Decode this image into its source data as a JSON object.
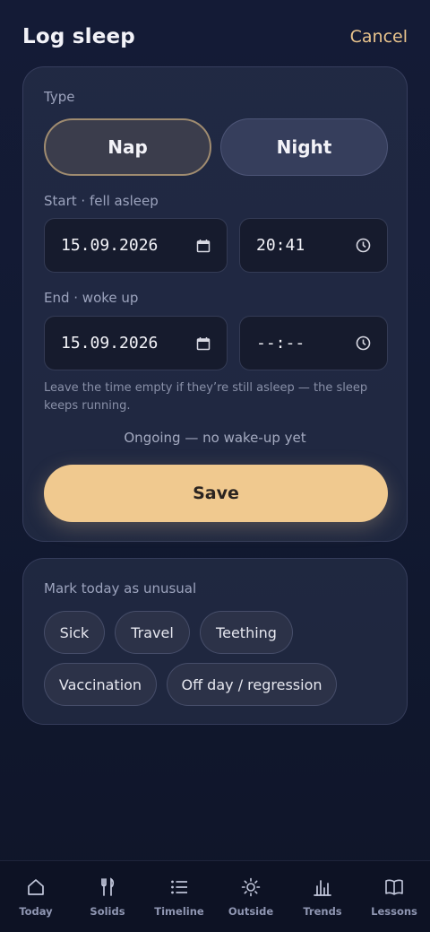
{
  "header": {
    "title": "Log sleep",
    "cancel_label": "Cancel"
  },
  "form": {
    "type_label": "Type",
    "types": [
      {
        "label": "Nap",
        "selected": true
      },
      {
        "label": "Night",
        "selected": false
      }
    ],
    "start_label": "Start · fell asleep",
    "start_date": "15.09.2026",
    "start_time": "20:41",
    "end_label": "End · woke up",
    "end_date": "15.09.2026",
    "end_time": "--:--",
    "hint": "Leave the time empty if they’re still asleep — the sleep keeps running.",
    "status": "Ongoing — no wake-up yet",
    "save_label": "Save",
    "icons": {
      "date": "calendar-icon",
      "time": "clock-icon"
    }
  },
  "unusual": {
    "label": "Mark today as unusual",
    "chips": [
      "Sick",
      "Travel",
      "Teething",
      "Vaccination",
      "Off day / regression"
    ]
  },
  "nav": {
    "items": [
      {
        "label": "Today",
        "icon": "home-icon"
      },
      {
        "label": "Solids",
        "icon": "utensils-icon"
      },
      {
        "label": "Timeline",
        "icon": "list-icon"
      },
      {
        "label": "Outside",
        "icon": "sun-icon"
      },
      {
        "label": "Trends",
        "icon": "chart-icon"
      },
      {
        "label": "Lessons",
        "icon": "book-icon"
      }
    ]
  },
  "colors": {
    "accent": "#f0c98f",
    "background": "#121a32",
    "card": "#2c344e",
    "muted_text": "#9ca3bd"
  }
}
